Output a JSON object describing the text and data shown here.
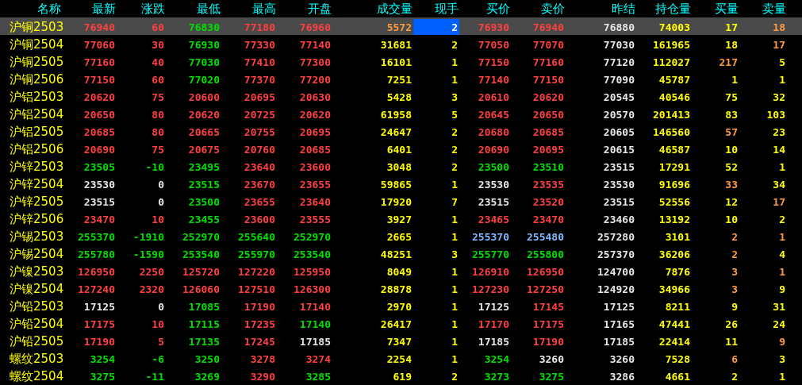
{
  "columns": [
    "名称",
    "最新",
    "涨跌",
    "最低",
    "最高",
    "开盘",
    "成交量",
    "现手",
    "买价",
    "卖价",
    "昨结",
    "持仓量",
    "买量",
    "卖量"
  ],
  "rows": [
    {
      "selected": true,
      "name": "沪铜2503",
      "cells": [
        {
          "text": "76940",
          "color": "#ff4040"
        },
        {
          "text": "60",
          "color": "#ff4040"
        },
        {
          "text": "76830",
          "color": "#00e000"
        },
        {
          "text": "77180",
          "color": "#ff4040"
        },
        {
          "text": "76960",
          "color": "#ff4040"
        },
        {
          "text": "5572",
          "color": "#ff9a40"
        },
        {
          "text": "2",
          "color": "#ffffff",
          "focused": true
        },
        {
          "text": "76930",
          "color": "#ff4040"
        },
        {
          "text": "76940",
          "color": "#ff4040"
        },
        {
          "text": "76880",
          "color": "#e6e6e6"
        },
        {
          "text": "74003",
          "color": "#ffff00"
        },
        {
          "text": "17",
          "color": "#ffff00"
        },
        {
          "text": "18",
          "color": "#ff9a40"
        }
      ]
    },
    {
      "selected": false,
      "name": "沪铜2504",
      "cells": [
        {
          "text": "77060",
          "color": "#ff4040"
        },
        {
          "text": "30",
          "color": "#ff4040"
        },
        {
          "text": "76930",
          "color": "#00e000"
        },
        {
          "text": "77330",
          "color": "#ff4040"
        },
        {
          "text": "77140",
          "color": "#ff4040"
        },
        {
          "text": "31681",
          "color": "#ffff00"
        },
        {
          "text": "2",
          "color": "#ffff00"
        },
        {
          "text": "77050",
          "color": "#ff4040"
        },
        {
          "text": "77070",
          "color": "#ff4040"
        },
        {
          "text": "77030",
          "color": "#e6e6e6"
        },
        {
          "text": "161965",
          "color": "#ffff00"
        },
        {
          "text": "18",
          "color": "#ffff00"
        },
        {
          "text": "17",
          "color": "#ff9a40"
        }
      ]
    },
    {
      "selected": false,
      "name": "沪铜2505",
      "cells": [
        {
          "text": "77160",
          "color": "#ff4040"
        },
        {
          "text": "40",
          "color": "#ff4040"
        },
        {
          "text": "77030",
          "color": "#00e000"
        },
        {
          "text": "77410",
          "color": "#ff4040"
        },
        {
          "text": "77300",
          "color": "#ff4040"
        },
        {
          "text": "16101",
          "color": "#ffff00"
        },
        {
          "text": "1",
          "color": "#ffff00"
        },
        {
          "text": "77150",
          "color": "#ff4040"
        },
        {
          "text": "77160",
          "color": "#ff4040"
        },
        {
          "text": "77120",
          "color": "#e6e6e6"
        },
        {
          "text": "112027",
          "color": "#ffff00"
        },
        {
          "text": "217",
          "color": "#ff9a40"
        },
        {
          "text": "5",
          "color": "#ffff00"
        }
      ]
    },
    {
      "selected": false,
      "name": "沪铜2506",
      "cells": [
        {
          "text": "77150",
          "color": "#ff4040"
        },
        {
          "text": "60",
          "color": "#ff4040"
        },
        {
          "text": "77020",
          "color": "#00e000"
        },
        {
          "text": "77370",
          "color": "#ff4040"
        },
        {
          "text": "77200",
          "color": "#ff4040"
        },
        {
          "text": "7251",
          "color": "#ffff00"
        },
        {
          "text": "1",
          "color": "#ffff00"
        },
        {
          "text": "77140",
          "color": "#ff4040"
        },
        {
          "text": "77150",
          "color": "#ff4040"
        },
        {
          "text": "77090",
          "color": "#e6e6e6"
        },
        {
          "text": "45787",
          "color": "#ffff00"
        },
        {
          "text": "1",
          "color": "#ffff00"
        },
        {
          "text": "1",
          "color": "#ffff00"
        }
      ]
    },
    {
      "selected": false,
      "name": "沪铝2503",
      "cells": [
        {
          "text": "20620",
          "color": "#ff4040"
        },
        {
          "text": "75",
          "color": "#ff4040"
        },
        {
          "text": "20600",
          "color": "#ff4040"
        },
        {
          "text": "20695",
          "color": "#ff4040"
        },
        {
          "text": "20630",
          "color": "#ff4040"
        },
        {
          "text": "5428",
          "color": "#ffff00"
        },
        {
          "text": "3",
          "color": "#ffff00"
        },
        {
          "text": "20610",
          "color": "#ff4040"
        },
        {
          "text": "20620",
          "color": "#ff4040"
        },
        {
          "text": "20545",
          "color": "#e6e6e6"
        },
        {
          "text": "40546",
          "color": "#ffff00"
        },
        {
          "text": "75",
          "color": "#ffff00"
        },
        {
          "text": "32",
          "color": "#ffff00"
        }
      ]
    },
    {
      "selected": false,
      "name": "沪铝2504",
      "cells": [
        {
          "text": "20650",
          "color": "#ff4040"
        },
        {
          "text": "80",
          "color": "#ff4040"
        },
        {
          "text": "20620",
          "color": "#ff4040"
        },
        {
          "text": "20725",
          "color": "#ff4040"
        },
        {
          "text": "20620",
          "color": "#ff4040"
        },
        {
          "text": "61958",
          "color": "#ffff00"
        },
        {
          "text": "5",
          "color": "#ffff00"
        },
        {
          "text": "20645",
          "color": "#ff4040"
        },
        {
          "text": "20650",
          "color": "#ff4040"
        },
        {
          "text": "20570",
          "color": "#e6e6e6"
        },
        {
          "text": "201413",
          "color": "#ffff00"
        },
        {
          "text": "83",
          "color": "#ffff00"
        },
        {
          "text": "103",
          "color": "#ffff00"
        }
      ]
    },
    {
      "selected": false,
      "name": "沪铝2505",
      "cells": [
        {
          "text": "20685",
          "color": "#ff4040"
        },
        {
          "text": "80",
          "color": "#ff4040"
        },
        {
          "text": "20665",
          "color": "#ff4040"
        },
        {
          "text": "20755",
          "color": "#ff4040"
        },
        {
          "text": "20695",
          "color": "#ff4040"
        },
        {
          "text": "24647",
          "color": "#ffff00"
        },
        {
          "text": "2",
          "color": "#ffff00"
        },
        {
          "text": "20680",
          "color": "#ff4040"
        },
        {
          "text": "20685",
          "color": "#ff4040"
        },
        {
          "text": "20605",
          "color": "#e6e6e6"
        },
        {
          "text": "146560",
          "color": "#ffff00"
        },
        {
          "text": "57",
          "color": "#ff9a40"
        },
        {
          "text": "23",
          "color": "#ffff00"
        }
      ]
    },
    {
      "selected": false,
      "name": "沪铝2506",
      "cells": [
        {
          "text": "20690",
          "color": "#ff4040"
        },
        {
          "text": "75",
          "color": "#ff4040"
        },
        {
          "text": "20675",
          "color": "#ff4040"
        },
        {
          "text": "20760",
          "color": "#ff4040"
        },
        {
          "text": "20685",
          "color": "#ff4040"
        },
        {
          "text": "6401",
          "color": "#ffff00"
        },
        {
          "text": "2",
          "color": "#ffff00"
        },
        {
          "text": "20690",
          "color": "#ff4040"
        },
        {
          "text": "20695",
          "color": "#ff4040"
        },
        {
          "text": "20615",
          "color": "#e6e6e6"
        },
        {
          "text": "46587",
          "color": "#ffff00"
        },
        {
          "text": "10",
          "color": "#ffff00"
        },
        {
          "text": "14",
          "color": "#ffff00"
        }
      ]
    },
    {
      "selected": false,
      "name": "沪锌2503",
      "cells": [
        {
          "text": "23505",
          "color": "#00e000"
        },
        {
          "text": "-10",
          "color": "#00e000"
        },
        {
          "text": "23495",
          "color": "#00e000"
        },
        {
          "text": "23640",
          "color": "#ff4040"
        },
        {
          "text": "23600",
          "color": "#ff4040"
        },
        {
          "text": "3048",
          "color": "#ffff00"
        },
        {
          "text": "2",
          "color": "#ffff00"
        },
        {
          "text": "23500",
          "color": "#00e000"
        },
        {
          "text": "23510",
          "color": "#00e000"
        },
        {
          "text": "23515",
          "color": "#e6e6e6"
        },
        {
          "text": "17291",
          "color": "#ffff00"
        },
        {
          "text": "52",
          "color": "#ffff00"
        },
        {
          "text": "1",
          "color": "#ffff00"
        }
      ]
    },
    {
      "selected": false,
      "name": "沪锌2504",
      "cells": [
        {
          "text": "23530",
          "color": "#e6e6e6"
        },
        {
          "text": "0",
          "color": "#e6e6e6"
        },
        {
          "text": "23515",
          "color": "#00e000"
        },
        {
          "text": "23670",
          "color": "#ff4040"
        },
        {
          "text": "23655",
          "color": "#ff4040"
        },
        {
          "text": "59865",
          "color": "#ffff00"
        },
        {
          "text": "1",
          "color": "#ffff00"
        },
        {
          "text": "23530",
          "color": "#e6e6e6"
        },
        {
          "text": "23535",
          "color": "#ff4040"
        },
        {
          "text": "23530",
          "color": "#e6e6e6"
        },
        {
          "text": "91696",
          "color": "#ffff00"
        },
        {
          "text": "33",
          "color": "#ff9a40"
        },
        {
          "text": "34",
          "color": "#ffff00"
        }
      ]
    },
    {
      "selected": false,
      "name": "沪锌2505",
      "cells": [
        {
          "text": "23515",
          "color": "#e6e6e6"
        },
        {
          "text": "0",
          "color": "#e6e6e6"
        },
        {
          "text": "23500",
          "color": "#00e000"
        },
        {
          "text": "23655",
          "color": "#ff4040"
        },
        {
          "text": "23640",
          "color": "#ff4040"
        },
        {
          "text": "17920",
          "color": "#ffff00"
        },
        {
          "text": "7",
          "color": "#ffff00"
        },
        {
          "text": "23515",
          "color": "#e6e6e6"
        },
        {
          "text": "23520",
          "color": "#ff4040"
        },
        {
          "text": "23515",
          "color": "#e6e6e6"
        },
        {
          "text": "52556",
          "color": "#ffff00"
        },
        {
          "text": "12",
          "color": "#ffff00"
        },
        {
          "text": "17",
          "color": "#ff9a40"
        }
      ]
    },
    {
      "selected": false,
      "name": "沪锌2506",
      "cells": [
        {
          "text": "23470",
          "color": "#ff4040"
        },
        {
          "text": "10",
          "color": "#ff4040"
        },
        {
          "text": "23455",
          "color": "#00e000"
        },
        {
          "text": "23600",
          "color": "#ff4040"
        },
        {
          "text": "23555",
          "color": "#ff4040"
        },
        {
          "text": "3927",
          "color": "#ffff00"
        },
        {
          "text": "1",
          "color": "#ffff00"
        },
        {
          "text": "23465",
          "color": "#ff4040"
        },
        {
          "text": "23470",
          "color": "#ff4040"
        },
        {
          "text": "23460",
          "color": "#e6e6e6"
        },
        {
          "text": "13192",
          "color": "#ffff00"
        },
        {
          "text": "10",
          "color": "#ffff00"
        },
        {
          "text": "2",
          "color": "#ffff00"
        }
      ]
    },
    {
      "selected": false,
      "name": "沪锡2503",
      "cells": [
        {
          "text": "255370",
          "color": "#00e000"
        },
        {
          "text": "-1910",
          "color": "#00e000"
        },
        {
          "text": "252970",
          "color": "#00e000"
        },
        {
          "text": "255640",
          "color": "#00e000"
        },
        {
          "text": "252970",
          "color": "#00e000"
        },
        {
          "text": "2665",
          "color": "#ffff00"
        },
        {
          "text": "1",
          "color": "#ffff00"
        },
        {
          "text": "255370",
          "color": "#80b8ff"
        },
        {
          "text": "255480",
          "color": "#80b8ff"
        },
        {
          "text": "257280",
          "color": "#e6e6e6"
        },
        {
          "text": "3101",
          "color": "#ffff00"
        },
        {
          "text": "2",
          "color": "#ff9a40"
        },
        {
          "text": "1",
          "color": "#ff9a40"
        }
      ]
    },
    {
      "selected": false,
      "name": "沪锡2504",
      "cells": [
        {
          "text": "255780",
          "color": "#00e000"
        },
        {
          "text": "-1590",
          "color": "#00e000"
        },
        {
          "text": "253540",
          "color": "#00e000"
        },
        {
          "text": "255970",
          "color": "#00e000"
        },
        {
          "text": "253540",
          "color": "#00e000"
        },
        {
          "text": "48251",
          "color": "#ffff00"
        },
        {
          "text": "3",
          "color": "#ffff00"
        },
        {
          "text": "255770",
          "color": "#00e000"
        },
        {
          "text": "255800",
          "color": "#00e000"
        },
        {
          "text": "257370",
          "color": "#e6e6e6"
        },
        {
          "text": "36206",
          "color": "#ffff00"
        },
        {
          "text": "2",
          "color": "#ff9a40"
        },
        {
          "text": "4",
          "color": "#ffff00"
        }
      ]
    },
    {
      "selected": false,
      "name": "沪镍2503",
      "cells": [
        {
          "text": "126950",
          "color": "#ff4040"
        },
        {
          "text": "2250",
          "color": "#ff4040"
        },
        {
          "text": "125720",
          "color": "#ff4040"
        },
        {
          "text": "127220",
          "color": "#ff4040"
        },
        {
          "text": "125950",
          "color": "#ff4040"
        },
        {
          "text": "8049",
          "color": "#ffff00"
        },
        {
          "text": "1",
          "color": "#ffff00"
        },
        {
          "text": "126910",
          "color": "#ff4040"
        },
        {
          "text": "126950",
          "color": "#ff4040"
        },
        {
          "text": "124700",
          "color": "#e6e6e6"
        },
        {
          "text": "7876",
          "color": "#ffff00"
        },
        {
          "text": "3",
          "color": "#ff9a40"
        },
        {
          "text": "1",
          "color": "#ff9a40"
        }
      ]
    },
    {
      "selected": false,
      "name": "沪镍2504",
      "cells": [
        {
          "text": "127240",
          "color": "#ff4040"
        },
        {
          "text": "2320",
          "color": "#ff4040"
        },
        {
          "text": "126060",
          "color": "#ff4040"
        },
        {
          "text": "127510",
          "color": "#ff4040"
        },
        {
          "text": "126300",
          "color": "#ff4040"
        },
        {
          "text": "28878",
          "color": "#ffff00"
        },
        {
          "text": "1",
          "color": "#ffff00"
        },
        {
          "text": "127230",
          "color": "#ff4040"
        },
        {
          "text": "127250",
          "color": "#ff4040"
        },
        {
          "text": "124920",
          "color": "#e6e6e6"
        },
        {
          "text": "34966",
          "color": "#ffff00"
        },
        {
          "text": "3",
          "color": "#ff9a40"
        },
        {
          "text": "9",
          "color": "#ffff00"
        }
      ]
    },
    {
      "selected": false,
      "name": "沪铅2503",
      "cells": [
        {
          "text": "17125",
          "color": "#e6e6e6"
        },
        {
          "text": "0",
          "color": "#e6e6e6"
        },
        {
          "text": "17085",
          "color": "#00e000"
        },
        {
          "text": "17190",
          "color": "#ff4040"
        },
        {
          "text": "17140",
          "color": "#ff4040"
        },
        {
          "text": "2970",
          "color": "#ffff00"
        },
        {
          "text": "1",
          "color": "#ffff00"
        },
        {
          "text": "17125",
          "color": "#e6e6e6"
        },
        {
          "text": "17145",
          "color": "#ff4040"
        },
        {
          "text": "17125",
          "color": "#e6e6e6"
        },
        {
          "text": "8211",
          "color": "#ffff00"
        },
        {
          "text": "9",
          "color": "#ffff00"
        },
        {
          "text": "31",
          "color": "#ffff00"
        }
      ]
    },
    {
      "selected": false,
      "name": "沪铅2504",
      "cells": [
        {
          "text": "17175",
          "color": "#ff4040"
        },
        {
          "text": "10",
          "color": "#ff4040"
        },
        {
          "text": "17115",
          "color": "#00e000"
        },
        {
          "text": "17235",
          "color": "#ff4040"
        },
        {
          "text": "17140",
          "color": "#00e000"
        },
        {
          "text": "26417",
          "color": "#ffff00"
        },
        {
          "text": "1",
          "color": "#ffff00"
        },
        {
          "text": "17170",
          "color": "#ff4040"
        },
        {
          "text": "17175",
          "color": "#ff4040"
        },
        {
          "text": "17165",
          "color": "#e6e6e6"
        },
        {
          "text": "47441",
          "color": "#ffff00"
        },
        {
          "text": "26",
          "color": "#ffff00"
        },
        {
          "text": "24",
          "color": "#ffff00"
        }
      ]
    },
    {
      "selected": false,
      "name": "沪铅2505",
      "cells": [
        {
          "text": "17190",
          "color": "#ff4040"
        },
        {
          "text": "5",
          "color": "#ff4040"
        },
        {
          "text": "17135",
          "color": "#00e000"
        },
        {
          "text": "17245",
          "color": "#ff4040"
        },
        {
          "text": "17185",
          "color": "#e6e6e6"
        },
        {
          "text": "7347",
          "color": "#ffff00"
        },
        {
          "text": "1",
          "color": "#ffff00"
        },
        {
          "text": "17185",
          "color": "#e6e6e6"
        },
        {
          "text": "17190",
          "color": "#ff4040"
        },
        {
          "text": "17185",
          "color": "#e6e6e6"
        },
        {
          "text": "22414",
          "color": "#ffff00"
        },
        {
          "text": "11",
          "color": "#ffff00"
        },
        {
          "text": "9",
          "color": "#ff9a40"
        }
      ]
    },
    {
      "selected": false,
      "name": "螺纹2503",
      "cells": [
        {
          "text": "3254",
          "color": "#00e000"
        },
        {
          "text": "-6",
          "color": "#00e000"
        },
        {
          "text": "3250",
          "color": "#00e000"
        },
        {
          "text": "3278",
          "color": "#ff4040"
        },
        {
          "text": "3274",
          "color": "#ff4040"
        },
        {
          "text": "2254",
          "color": "#ffff00"
        },
        {
          "text": "1",
          "color": "#ffff00"
        },
        {
          "text": "3254",
          "color": "#00e000"
        },
        {
          "text": "3260",
          "color": "#e6e6e6"
        },
        {
          "text": "3260",
          "color": "#e6e6e6"
        },
        {
          "text": "7528",
          "color": "#ffff00"
        },
        {
          "text": "6",
          "color": "#ff9a40"
        },
        {
          "text": "3",
          "color": "#ffff00"
        }
      ]
    },
    {
      "selected": false,
      "name": "螺纹2504",
      "cells": [
        {
          "text": "3275",
          "color": "#00e000"
        },
        {
          "text": "-11",
          "color": "#00e000"
        },
        {
          "text": "3269",
          "color": "#00e000"
        },
        {
          "text": "3290",
          "color": "#ff4040"
        },
        {
          "text": "3285",
          "color": "#00e000"
        },
        {
          "text": "619",
          "color": "#ffff00"
        },
        {
          "text": "2",
          "color": "#ffff00"
        },
        {
          "text": "3273",
          "color": "#00e000"
        },
        {
          "text": "3275",
          "color": "#00e000"
        },
        {
          "text": "3286",
          "color": "#e6e6e6"
        },
        {
          "text": "4661",
          "color": "#ffff00"
        },
        {
          "text": "2",
          "color": "#ffff00"
        },
        {
          "text": "1",
          "color": "#ffff00"
        }
      ]
    }
  ]
}
